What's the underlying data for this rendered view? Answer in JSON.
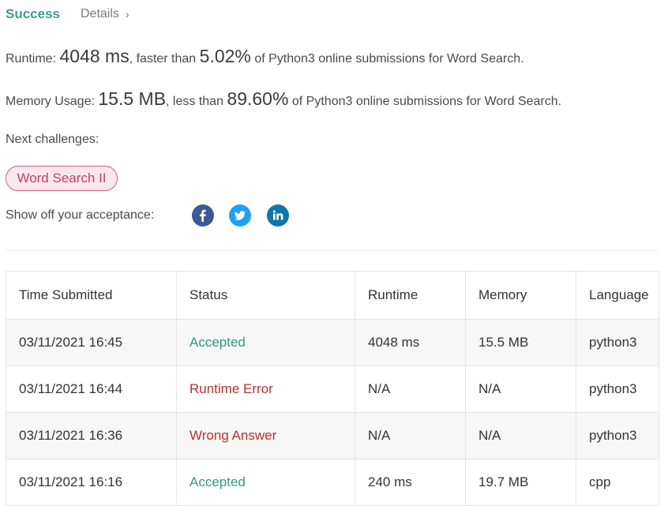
{
  "header": {
    "status": "Success",
    "details_label": "Details",
    "details_chevron": "›"
  },
  "runtime": {
    "label": "Runtime:",
    "value": "4048 ms",
    "comparison": ", faster than",
    "percent": "5.02%",
    "suffix": "of Python3 online submissions for Word Search."
  },
  "memory": {
    "label": "Memory Usage:",
    "value": "15.5 MB",
    "comparison": ", less than",
    "percent": "89.60%",
    "suffix": "of Python3 online submissions for Word Search."
  },
  "next_challenges": {
    "label": "Next challenges:",
    "items": [
      "Word Search II"
    ]
  },
  "share": {
    "label": "Show off your acceptance:",
    "icons": [
      "facebook-icon",
      "twitter-icon",
      "linkedin-icon"
    ],
    "colors": {
      "facebook": "#3b5998",
      "twitter": "#1da1f2",
      "linkedin": "#0e76a8"
    }
  },
  "table": {
    "headers": [
      "Time Submitted",
      "Status",
      "Runtime",
      "Memory",
      "Language"
    ],
    "rows": [
      {
        "time": "03/11/2021 16:45",
        "status": "Accepted",
        "runtime": "4048 ms",
        "memory": "15.5 MB",
        "language": "python3"
      },
      {
        "time": "03/11/2021 16:44",
        "status": "Runtime Error",
        "runtime": "N/A",
        "memory": "N/A",
        "language": "python3"
      },
      {
        "time": "03/11/2021 16:36",
        "status": "Wrong Answer",
        "runtime": "N/A",
        "memory": "N/A",
        "language": "python3"
      },
      {
        "time": "03/11/2021 16:16",
        "status": "Accepted",
        "runtime": "240 ms",
        "memory": "19.7 MB",
        "language": "cpp"
      }
    ]
  },
  "colors": {
    "success": "#3c9e8e",
    "accepted": "#2f9a7b",
    "error": "#b8312f",
    "challenge": "#c13f6b"
  }
}
